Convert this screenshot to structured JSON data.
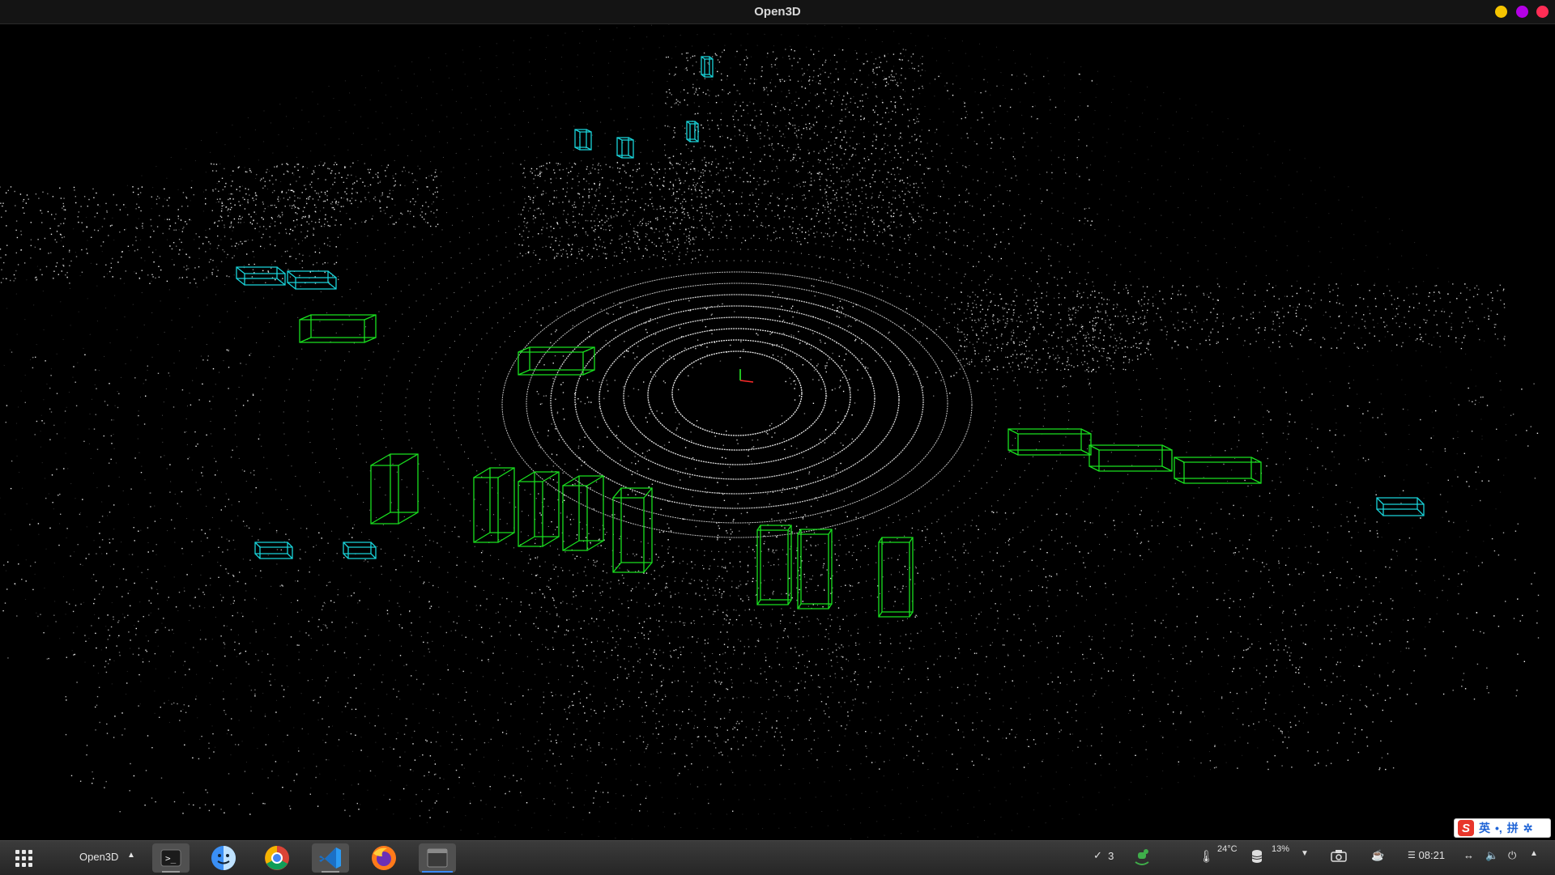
{
  "window": {
    "title": "Open3D"
  },
  "viewer": {
    "point_color": "#ffffff",
    "car_box_color": "#19e01f",
    "pedestrian_box_color": "#19d3d9",
    "axis_colors": [
      "#ff2a2a",
      "#2aff2a"
    ]
  },
  "ime": {
    "logo": "S",
    "mode": "英",
    "punct": "•,",
    "pinyin": "拼",
    "settings_icon": "gear-icon"
  },
  "taskbar": {
    "active_window_label": "Open3D",
    "dock_apps": [
      "terminal-icon",
      "finder-icon",
      "chrome-icon",
      "vscode-icon",
      "firefox-icon",
      "open3d-window-icon"
    ],
    "tray": {
      "notifications_count": "3",
      "temperature": "24°C",
      "disk_usage": "13%",
      "clock": "08:21"
    }
  }
}
